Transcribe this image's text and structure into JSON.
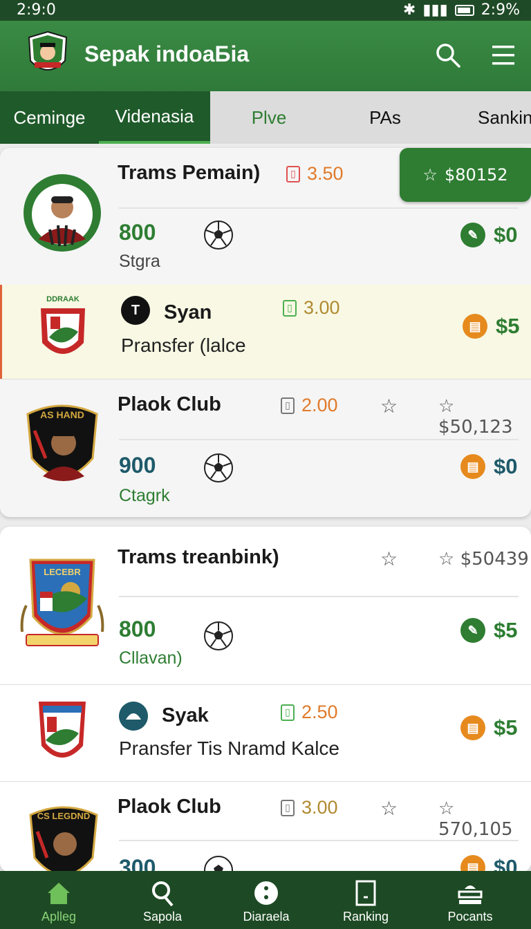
{
  "status": {
    "time": "2:9:0",
    "battery": "2:9%"
  },
  "app": {
    "title": "Sepak indoaБia"
  },
  "tabs": [
    "Cеminge",
    "Videnasia",
    "Plve",
    "PAs",
    "Sanking"
  ],
  "top_badge": {
    "value": "$80152"
  },
  "card1": {
    "rows": [
      {
        "name": "Trams Pemain)",
        "odds": "3.50",
        "points": "800",
        "position": "Stgra",
        "price": "$0"
      },
      {
        "name": "Syan",
        "odds": "3.00",
        "subtitle": "Pransfer (lalce",
        "price": "$5"
      },
      {
        "name": "Plaok Club",
        "odds": "2.00",
        "value": "$50,123",
        "points": "900",
        "position": "Ctagrk",
        "price": "$0"
      }
    ]
  },
  "card2": {
    "rows": [
      {
        "name": "Trams treanbink)",
        "value": "$50439",
        "points": "800",
        "position": "Cllavan)",
        "price": "$5"
      },
      {
        "name": "Syak",
        "odds": "2.50",
        "subtitle": "Pransfer Tis Nramd Kalce",
        "price": "$5"
      },
      {
        "name": "Plaok Club",
        "odds": "3.00",
        "value": "570,105",
        "points": "300",
        "price": "$0"
      }
    ]
  },
  "nav": [
    "Aplleg",
    "Sapola",
    "Diaraela",
    "Ranking",
    "Pocants"
  ],
  "colors": {
    "primary": "#2f7a39",
    "dark": "#1d4a24",
    "accent_orange": "#e68a1e",
    "highlight": "#f8f8e4"
  },
  "icons": [
    "search-icon",
    "menu-icon",
    "soccer-ball-icon",
    "star-icon",
    "odds-icon",
    "wallet-icon",
    "home-icon",
    "search-nav-icon",
    "more-icon",
    "ranking-icon",
    "points-icon"
  ]
}
